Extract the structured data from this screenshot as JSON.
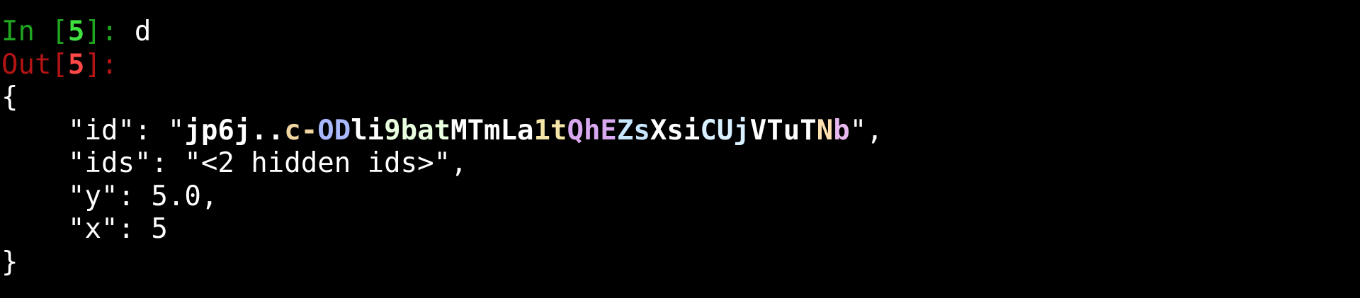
{
  "colors": {
    "background": "#000000",
    "in_prompt": "#1fa51f",
    "in_number": "#3fe03f",
    "out_prompt": "#b31414",
    "out_number": "#ff4747",
    "text": "#ffffff"
  },
  "input": {
    "prompt_prefix": "In [",
    "number": "5",
    "prompt_suffix": "]: ",
    "command": "d"
  },
  "output": {
    "prompt_prefix": "Out[",
    "number": "5",
    "prompt_suffix": "]:"
  },
  "result": {
    "open_brace": "{",
    "close_brace": "}",
    "fields": [
      {
        "key": "\"id\": ",
        "value": "\"jp6j..c-ODli9batMTmLa1tQhEZsXsiCUjVTuTNb\"",
        "trail": ","
      },
      {
        "key": "\"ids\": ",
        "value": "\"<2 hidden ids>\"",
        "trail": ","
      },
      {
        "key": "\"y\": ",
        "value": "5.0",
        "trail": ","
      },
      {
        "key": "\"x\": ",
        "value": "5",
        "trail": ""
      }
    ],
    "id_segments": [
      {
        "text": "\"",
        "color": "#ffffff",
        "bold": false
      },
      {
        "text": "jp6j..",
        "color": "#ffffff",
        "bold": true
      },
      {
        "text": "c-",
        "color": "#f2d6a0",
        "bold": true
      },
      {
        "text": "OD",
        "color": "#a9b8ff",
        "bold": true
      },
      {
        "text": "li",
        "color": "#ffffff",
        "bold": true
      },
      {
        "text": "9bat",
        "color": "#e8ffe0",
        "bold": true
      },
      {
        "text": "MTmLa",
        "color": "#ffffff",
        "bold": true
      },
      {
        "text": "1t",
        "color": "#f5e6a8",
        "bold": true
      },
      {
        "text": "QhE",
        "color": "#d8a8f0",
        "bold": true
      },
      {
        "text": "Zs",
        "color": "#c8e8ff",
        "bold": true
      },
      {
        "text": "Xsi",
        "color": "#ffffff",
        "bold": true
      },
      {
        "text": "CUj",
        "color": "#d8f0ff",
        "bold": true
      },
      {
        "text": "VTuT",
        "color": "#ffffff",
        "bold": true
      },
      {
        "text": "N",
        "color": "#ffe0b0",
        "bold": true
      },
      {
        "text": "b",
        "color": "#e8b8f0",
        "bold": true
      },
      {
        "text": "\"",
        "color": "#ffffff",
        "bold": false
      }
    ]
  }
}
